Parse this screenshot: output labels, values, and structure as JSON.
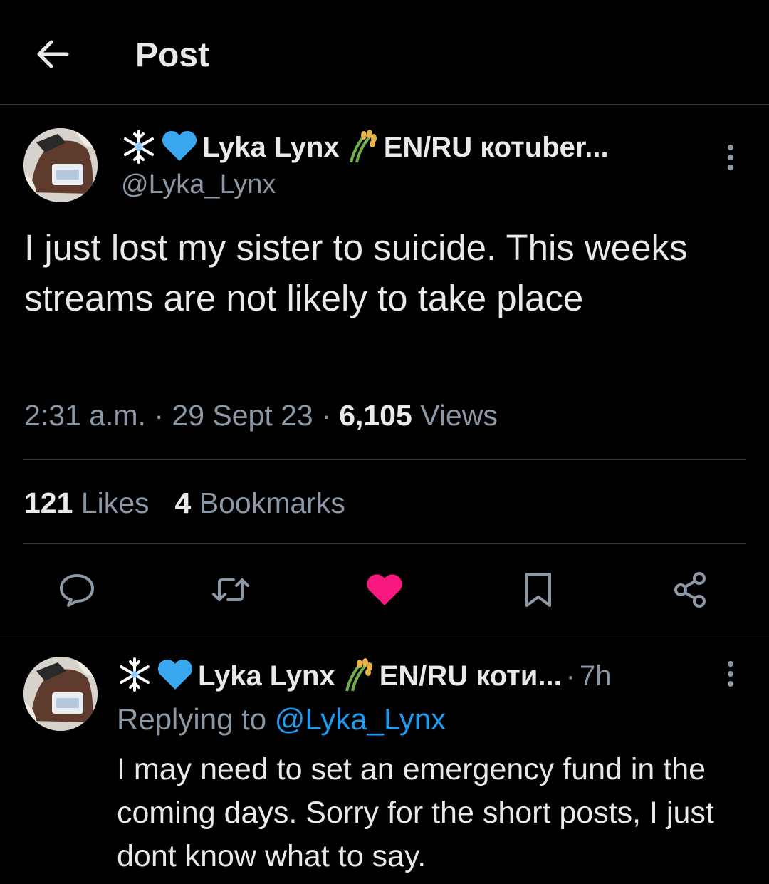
{
  "header": {
    "title": "Post"
  },
  "post": {
    "emoji_prefix": "❄💙",
    "display_name": "Lyka Lynx",
    "name_suffix": "EN/RU котuber...",
    "handle": "@Lyka_Lynx",
    "text": "I just lost my sister to suicide. This weeks streams are not likely to take place",
    "time": "2:31 a.m.",
    "date": "29 Sept 23",
    "views_count": "6,105",
    "views_label": "Views",
    "likes_count": "121",
    "likes_label": "Likes",
    "bookmarks_count": "4",
    "bookmarks_label": "Bookmarks",
    "liked": true
  },
  "reply": {
    "emoji_prefix": "❄💙",
    "display_name": "Lyka Lynx",
    "name_suffix": "EN/RU коти...",
    "time": "7h",
    "replying_prefix": "Replying to",
    "replying_handle": "@Lyka_Lynx",
    "text": "I may need to set an emergency fund in the coming days. Sorry for the short posts, I just dont know what to say."
  },
  "colors": {
    "background": "#000000",
    "text": "#e7e9ea",
    "muted": "#8b98a5",
    "accent": "#1d9bf0",
    "like": "#f91880",
    "heart_emoji": "#3aa8f0"
  },
  "icons": {
    "back": "arrow-left-icon",
    "more": "more-vertical-icon",
    "reply": "reply-bubble-icon",
    "repost": "repost-icon",
    "like": "heart-filled-icon",
    "bookmark": "bookmark-icon",
    "share": "share-icon",
    "plant": "rice-sheaf-icon"
  }
}
